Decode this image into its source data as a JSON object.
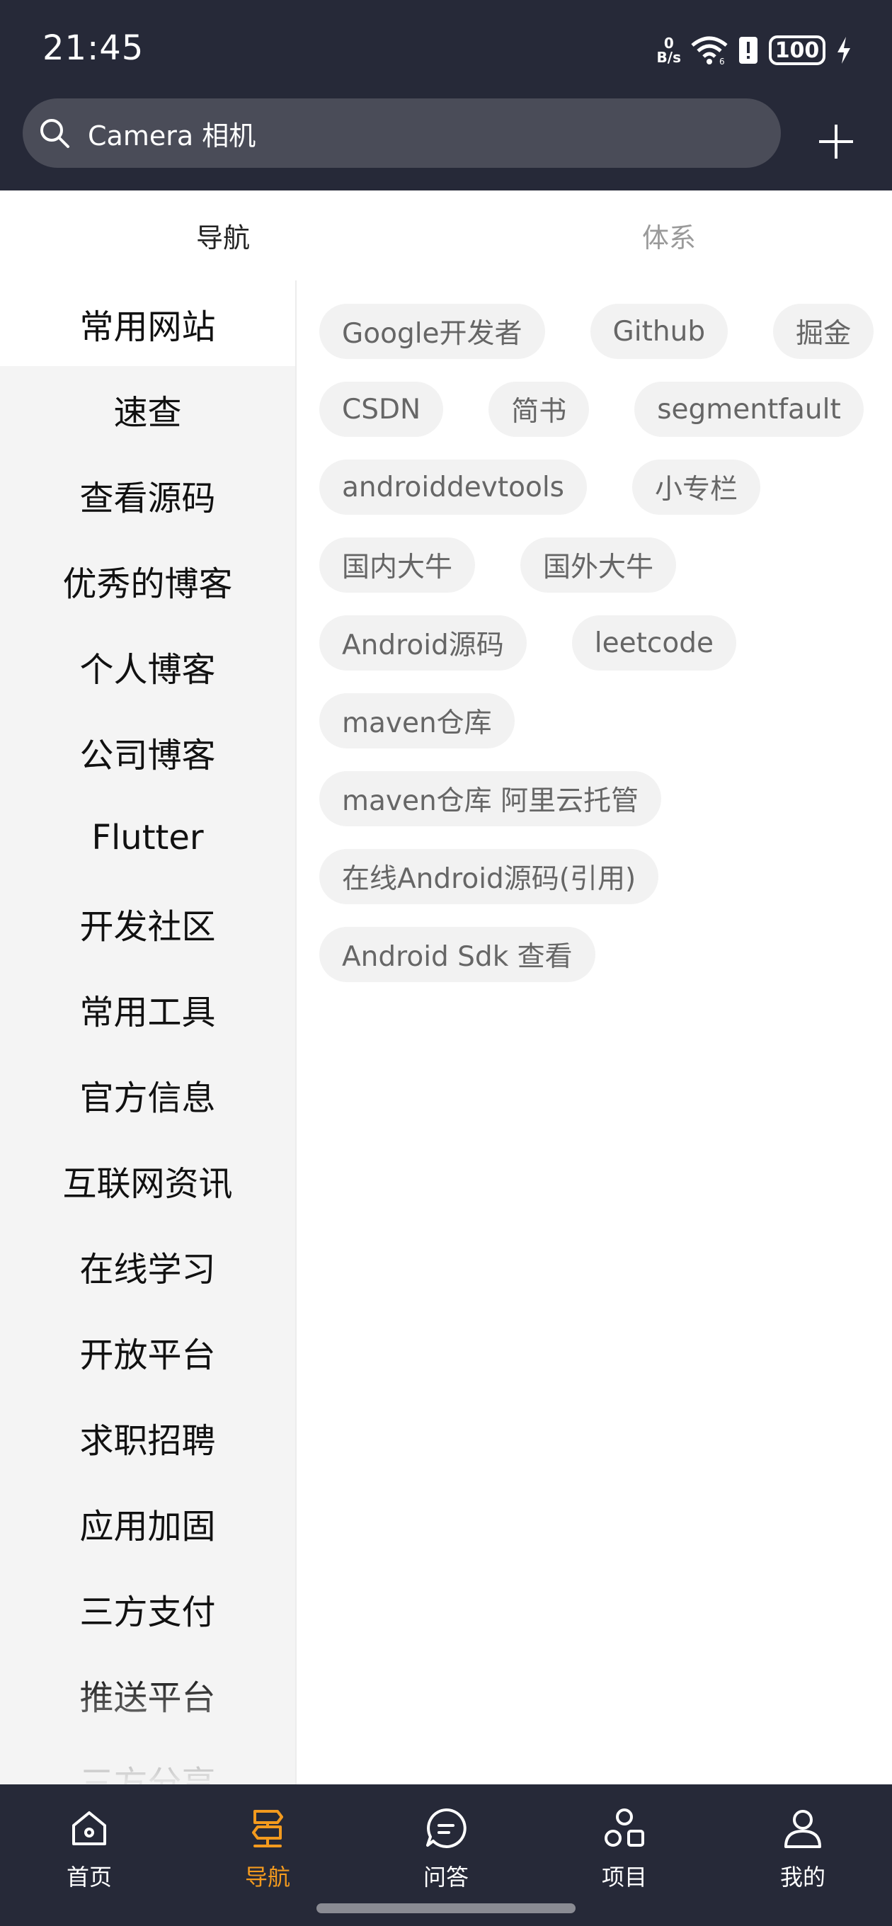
{
  "status_bar": {
    "time": "21:45",
    "net_speed_value": "0",
    "net_speed_unit": "B/s",
    "battery": "100",
    "icons": [
      "wifi-icon",
      "alert-icon",
      "battery-icon",
      "charging-icon"
    ]
  },
  "search": {
    "text": "Camera 相机",
    "icon": "search-icon"
  },
  "add_icon": "plus-icon",
  "tabs": [
    {
      "label": "导航",
      "active": true
    },
    {
      "label": "体系",
      "active": false
    }
  ],
  "sidebar": {
    "items": [
      {
        "label": "常用网站",
        "active": true
      },
      {
        "label": "速查"
      },
      {
        "label": "查看源码"
      },
      {
        "label": "优秀的博客"
      },
      {
        "label": "个人博客"
      },
      {
        "label": "公司博客"
      },
      {
        "label": "Flutter"
      },
      {
        "label": "开发社区"
      },
      {
        "label": "常用工具"
      },
      {
        "label": "官方信息"
      },
      {
        "label": "互联网资讯"
      },
      {
        "label": "在线学习"
      },
      {
        "label": "开放平台"
      },
      {
        "label": "求职招聘"
      },
      {
        "label": "应用加固"
      },
      {
        "label": "三方支付"
      },
      {
        "label": "推送平台"
      },
      {
        "label": "三方分享"
      }
    ]
  },
  "chips": {
    "rows": [
      [
        "Google开发者",
        "Github",
        "掘金"
      ],
      [
        "CSDN",
        "简书",
        "segmentfault"
      ],
      [
        "androiddevtools",
        "小专栏"
      ],
      [
        "国内大牛",
        "国外大牛"
      ],
      [
        "Android源码",
        "leetcode"
      ],
      [
        "maven仓库"
      ],
      [
        "maven仓库 阿里云托管"
      ],
      [
        "在线Android源码(引用)"
      ],
      [
        "Android Sdk 查看"
      ]
    ]
  },
  "bottom_nav": {
    "active_color": "#f39a1e",
    "items": [
      {
        "label": "首页",
        "icon": "home-icon"
      },
      {
        "label": "导航",
        "icon": "signpost-icon",
        "active": true
      },
      {
        "label": "问答",
        "icon": "chat-bubble-icon"
      },
      {
        "label": "项目",
        "icon": "shapes-icon"
      },
      {
        "label": "我的",
        "icon": "user-icon"
      }
    ]
  }
}
